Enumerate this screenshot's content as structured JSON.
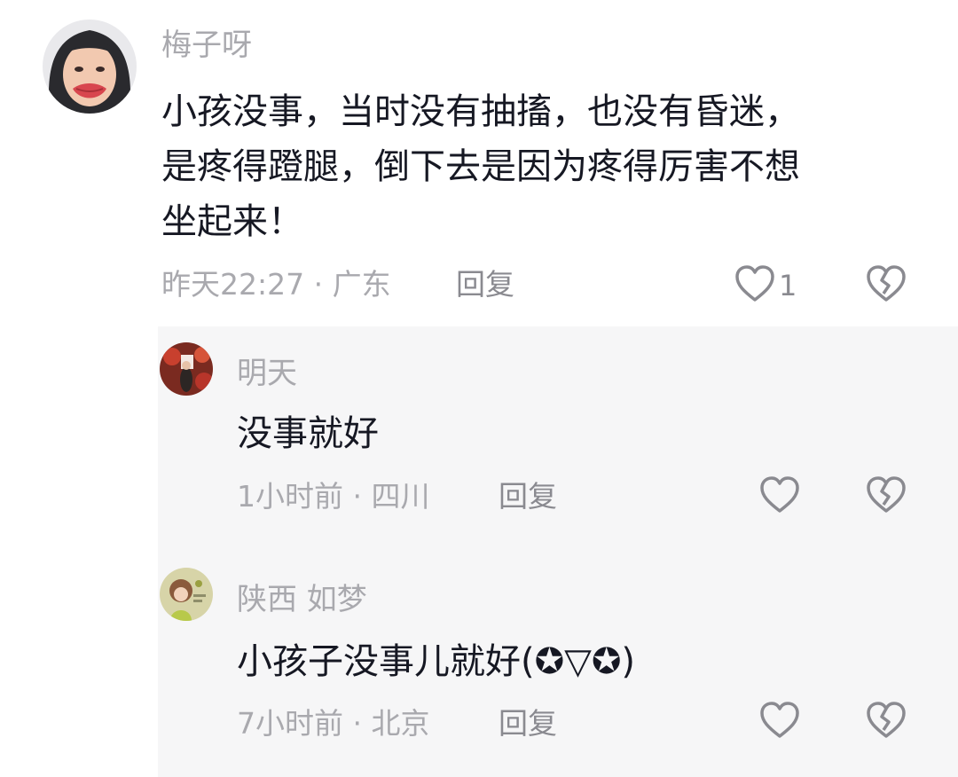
{
  "comments": [
    {
      "author": "梅子呀",
      "lines": [
        "小孩没事，当时没有抽搐，也没有昏迷，",
        "是疼得蹬腿，倒下去是因为疼得厉害不想",
        "坐起来！"
      ],
      "time_location": "昨天22:27 · 广东",
      "reply_label": "回复",
      "like_count": "1"
    }
  ],
  "replies": [
    {
      "author": "明天",
      "text": "没事就好",
      "time_location": "1小时前 · 四川",
      "reply_label": "回复"
    },
    {
      "author": "陕西  如梦",
      "text": "小孩子没事儿就好(✪▽✪)",
      "time_location": "7小时前 · 北京",
      "reply_label": "回复"
    }
  ],
  "icons": {
    "like": "heart-outline-icon",
    "dislike": "broken-heart-icon"
  },
  "colors": {
    "text": "#161823",
    "meta": "#a9a9ae",
    "reply_bg": "#f6f6f7"
  }
}
